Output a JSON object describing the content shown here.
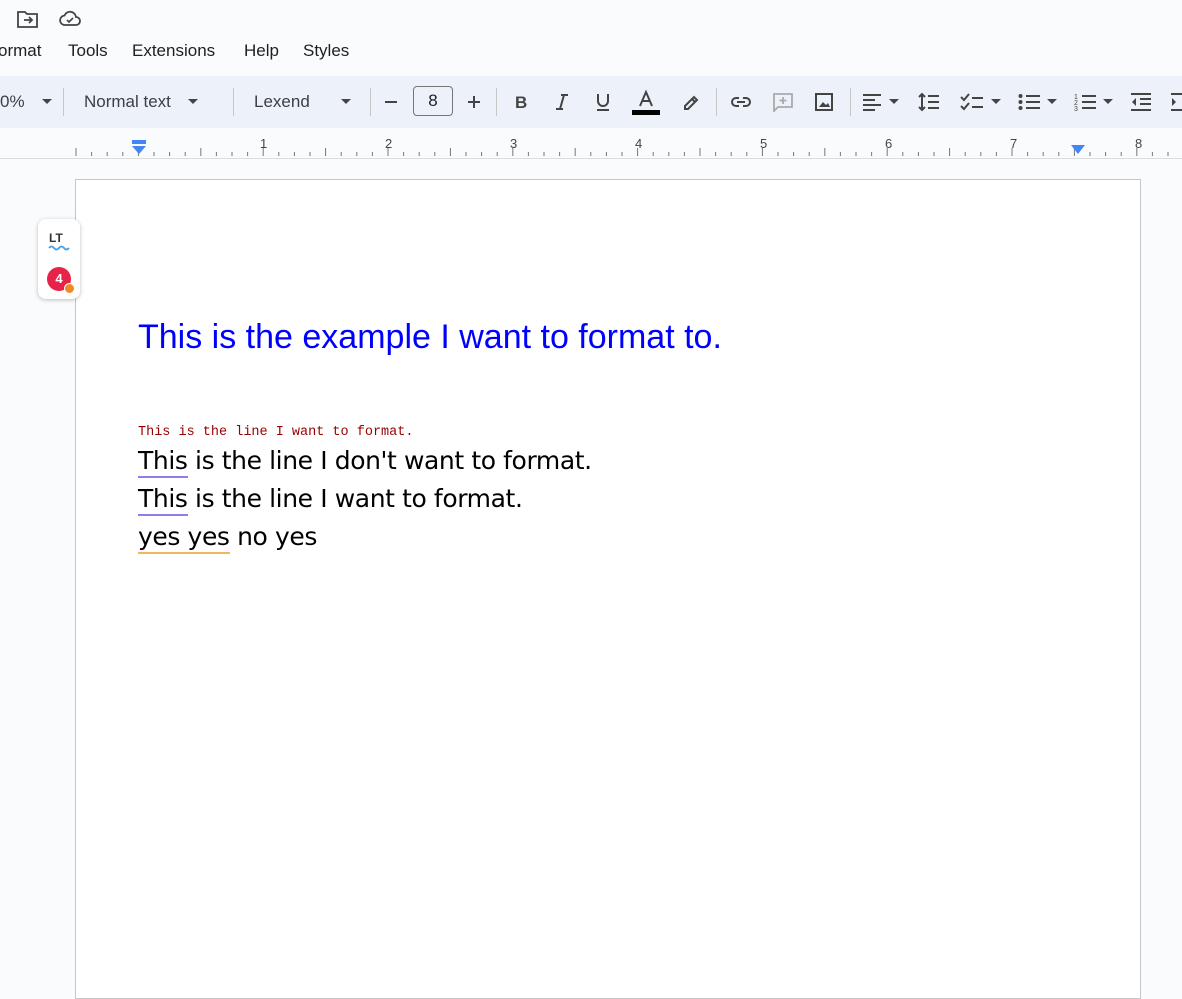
{
  "menu": {
    "format": "ormat",
    "tools": "Tools",
    "extensions": "Extensions",
    "help": "Help",
    "styles": "Styles"
  },
  "toolbar": {
    "zoom": "0%",
    "paragraph_style": "Normal text",
    "font": "Lexend",
    "font_size": "8",
    "text_color": "#000000"
  },
  "ruler": {
    "numbers": [
      "1",
      "2",
      "3",
      "4",
      "5",
      "6",
      "7",
      "8"
    ]
  },
  "languagetool": {
    "logo": "LT",
    "issue_count": "4"
  },
  "document": {
    "heading": "This is the example I want to format to.",
    "mono_line": "This is the line I want to format.",
    "line1_word": "This",
    "line1_rest": " is the line I don't want to format.",
    "line2_word": "This",
    "line2_rest": " is the line I want to format.",
    "line3_underlined": "yes yes",
    "line3_rest": " no yes"
  },
  "colors": {
    "heading": "#0000ff",
    "mono_line": "#980000",
    "spell_underline_purple": "#8b7ff0",
    "spell_underline_orange": "#f4b561"
  }
}
